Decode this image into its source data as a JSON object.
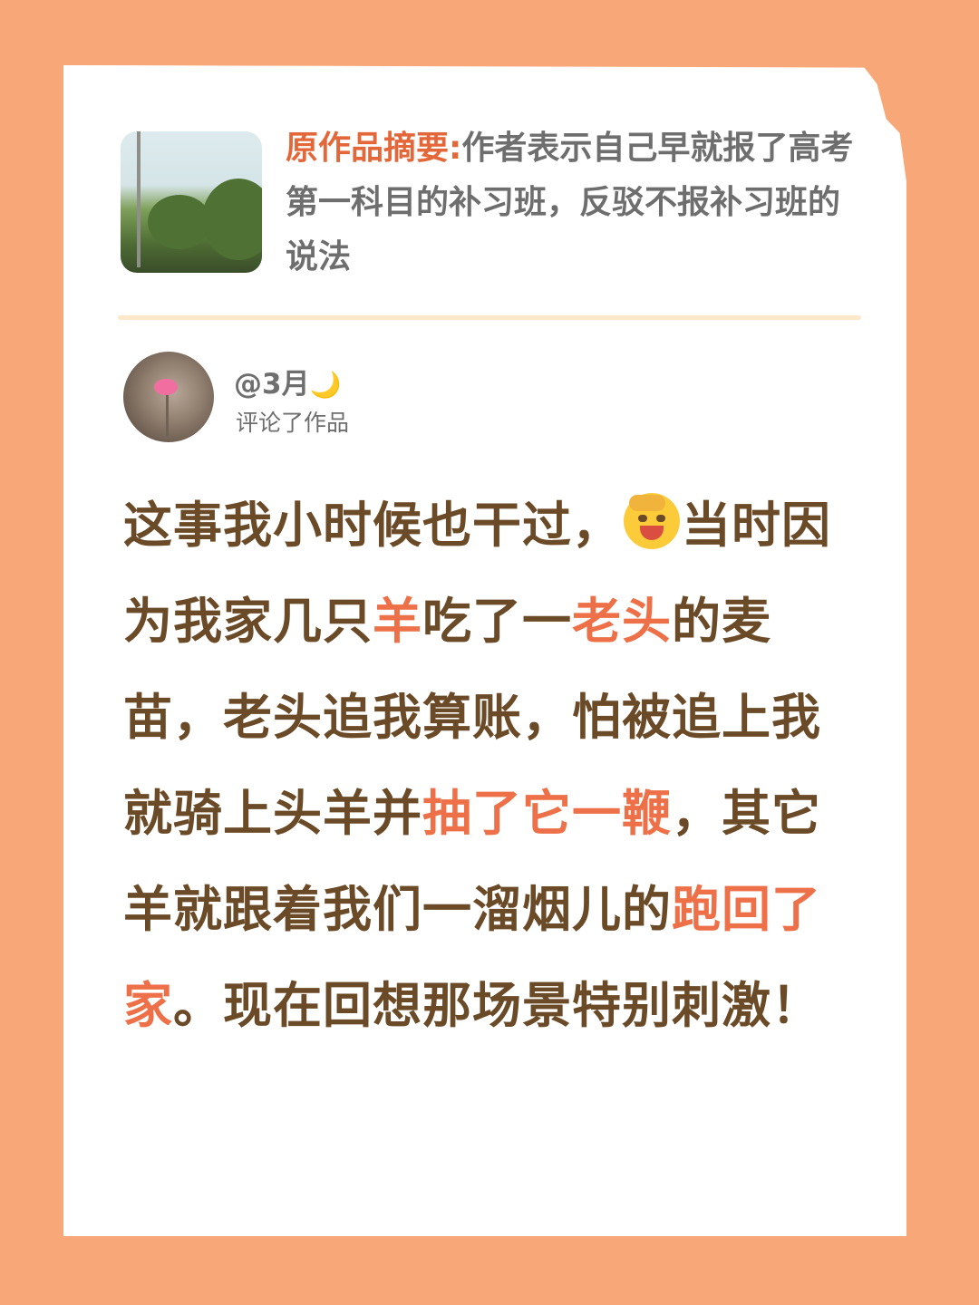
{
  "summary": {
    "label": "原作品摘要:",
    "text": "作者表示自己早就报了高考第一科目的补习班，反驳不报补习班的说法"
  },
  "user": {
    "handle": "@3月",
    "moon_glyph": "🌙",
    "action": "评论了作品"
  },
  "comment": {
    "seg1": "这事我小时候也干过，",
    "emoji_icon": "face-palm-laughing-emoji",
    "seg2": "当时因为我家几只",
    "hl1": "羊",
    "seg3": "吃了一",
    "hl2": "老头",
    "seg4": "的麦苗，老头追我算账，怕被追上我就骑上头羊并",
    "hl3": "抽了它一鞭",
    "seg5": "，其它羊就跟着我们一溜烟儿的",
    "hl4": "跑回了家",
    "seg6": "。现在回想那场景特别刺激！"
  },
  "colors": {
    "background": "#F8A878",
    "card": "#FFFFFF",
    "label": "#E4673A",
    "body_text": "#6B4A27",
    "highlight": "#ED7048"
  }
}
